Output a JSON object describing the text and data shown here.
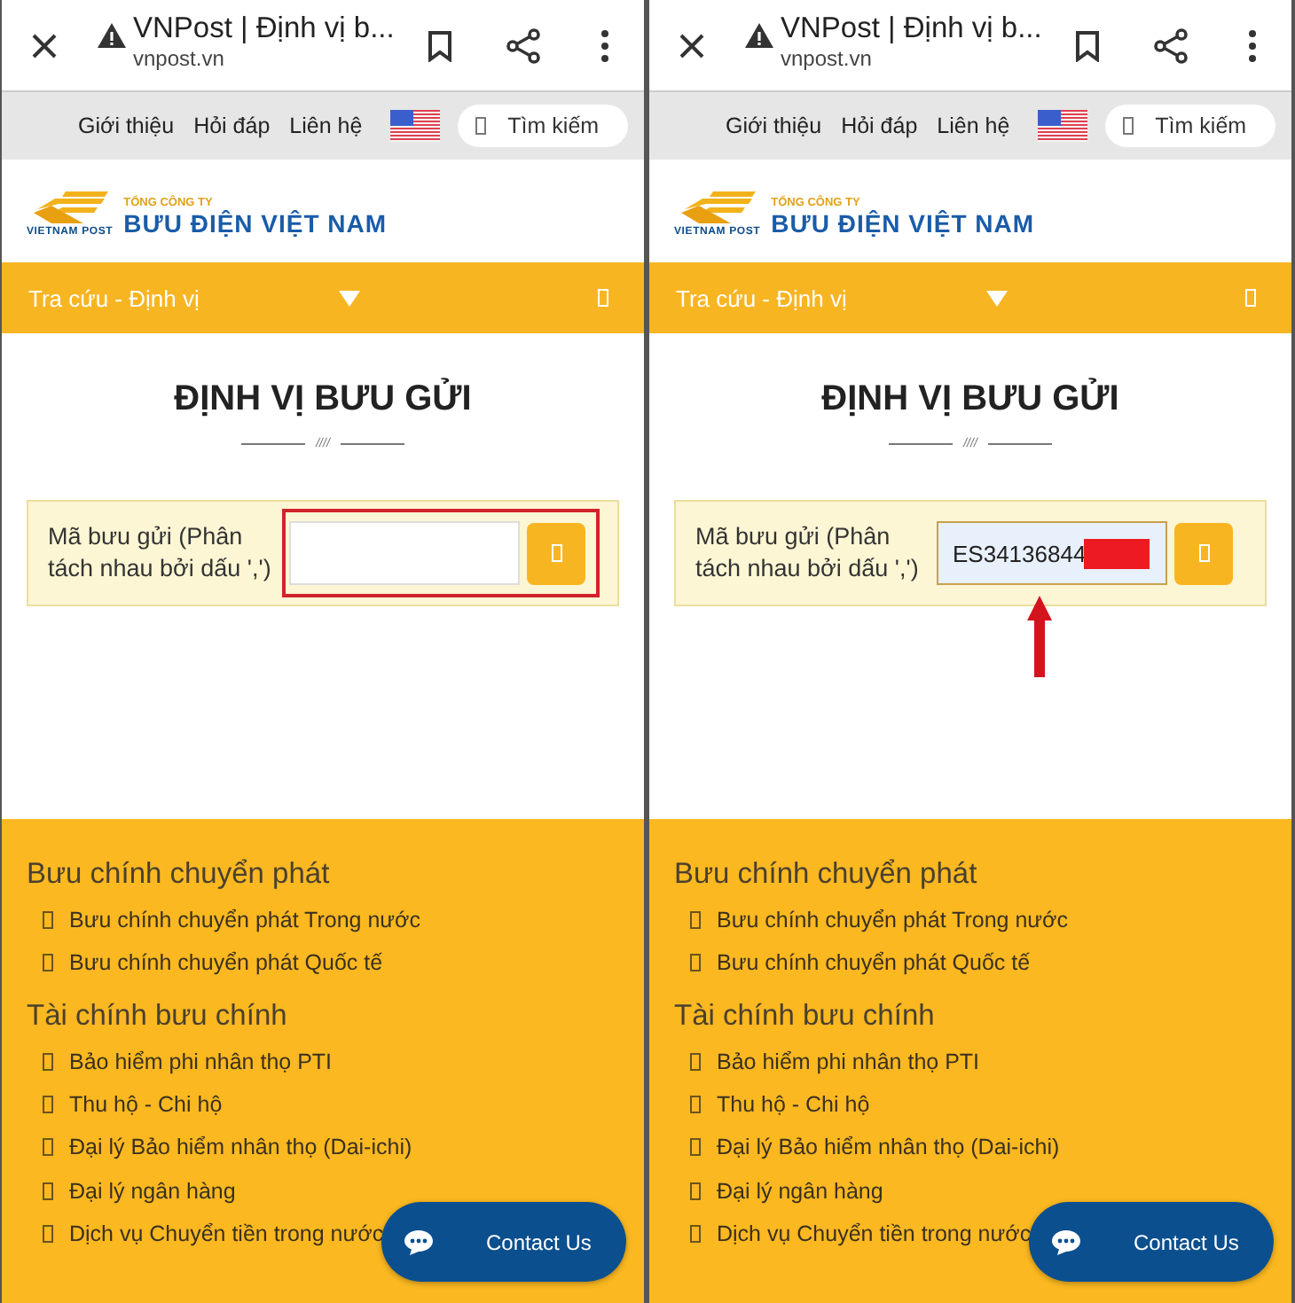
{
  "panels": [
    {
      "browser": {
        "title": "VNPost | Định vị b...",
        "url": "vnpost.vn"
      },
      "nav": {
        "links": [
          "Giới thiệu",
          "Hỏi đáp",
          "Liên hệ"
        ],
        "search": "Tìm kiếm"
      },
      "logo": {
        "mark": "VIETNAM POST",
        "tagline": "TỔNG CÔNG TY",
        "name": "BƯU ĐIỆN VIỆT NAM"
      },
      "menu": {
        "label": "Tra cứu - Định vị"
      },
      "heading": "ĐỊNH VỊ BƯU GỬI",
      "divider_mark": "////",
      "form": {
        "label": "Mã bưu gửi (Phân tách nhau bởi dấu ',')",
        "highlighted": true,
        "redacted": false,
        "arrow": false
      },
      "footer": [
        {
          "title": "Bưu chính chuyển phát",
          "items": [
            "Bưu chính chuyển phát Trong nước",
            "Bưu chính chuyển phát Quốc tế"
          ]
        },
        {
          "title": "Tài chính bưu chính",
          "items": [
            "Bảo hiểm phi nhân thọ PTI",
            "Thu hộ - Chi hộ",
            "Đại lý Bảo hiểm nhân thọ (Dai-ichi)",
            "Đại lý ngân hàng",
            "Dịch vụ Chuyển tiền trong nước"
          ]
        }
      ],
      "contact": "Contact Us"
    },
    {
      "browser": {
        "title": "VNPost | Định vị b...",
        "url": "vnpost.vn"
      },
      "nav": {
        "links": [
          "Giới thiệu",
          "Hỏi đáp",
          "Liên hệ"
        ],
        "search": "Tìm kiếm"
      },
      "logo": {
        "mark": "VIETNAM POST",
        "tagline": "TỔNG CÔNG TY",
        "name": "BƯU ĐIỆN VIỆT NAM"
      },
      "menu": {
        "label": "Tra cứu - Định vị"
      },
      "heading": "ĐỊNH VỊ BƯU GỬI",
      "divider_mark": "////",
      "form": {
        "label": "Mã bưu gửi (Phân tách nhau bởi dấu ',')",
        "value": "ES34136844",
        "highlighted": false,
        "redacted": true,
        "arrow": true
      },
      "footer": [
        {
          "title": "Bưu chính chuyển phát",
          "items": [
            "Bưu chính chuyển phát Trong nước",
            "Bưu chính chuyển phát Quốc tế"
          ]
        },
        {
          "title": "Tài chính bưu chính",
          "items": [
            "Bảo hiểm phi nhân thọ PTI",
            "Thu hộ - Chi hộ",
            "Đại lý Bảo hiểm nhân thọ (Dai-ichi)",
            "Đại lý ngân hàng",
            "Dịch vụ Chuyển tiền trong nước"
          ]
        }
      ],
      "contact": "Contact Us"
    }
  ]
}
